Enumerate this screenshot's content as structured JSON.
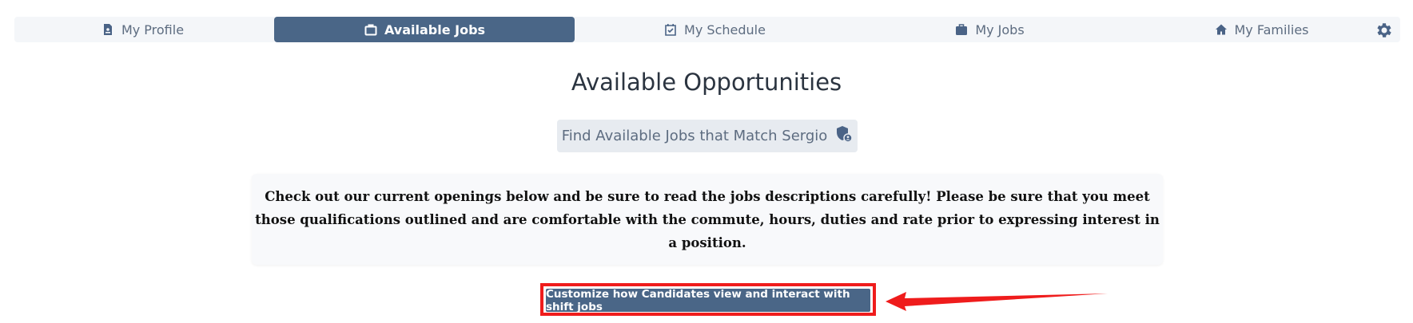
{
  "nav": {
    "items": [
      {
        "label": "My Profile",
        "icon": "id-card-icon"
      },
      {
        "label": "Available Jobs",
        "icon": "briefcase-outline-icon",
        "active": true
      },
      {
        "label": "My Schedule",
        "icon": "calendar-check-icon"
      },
      {
        "label": "My Jobs",
        "icon": "briefcase-icon"
      },
      {
        "label": "My Families",
        "icon": "home-icon"
      }
    ],
    "settings_icon": "gear-icon"
  },
  "main": {
    "title": "Available Opportunities",
    "find_button": {
      "label": "Find Available Jobs that Match Sergio",
      "icon": "shield-user-icon"
    },
    "notice": "Check out our current openings below and be sure to read the jobs descriptions carefully! Please be sure that you meet those qualifications outlined and are comfortable with the commute, hours, duties and rate prior to expressing interest in a position.",
    "customize_button": {
      "label": "Customize how Candidates view and interact with shift jobs"
    }
  },
  "colors": {
    "accent": "#4a6687",
    "nav_bg": "#f4f6f9",
    "annotation_red": "#ef1c1c"
  }
}
